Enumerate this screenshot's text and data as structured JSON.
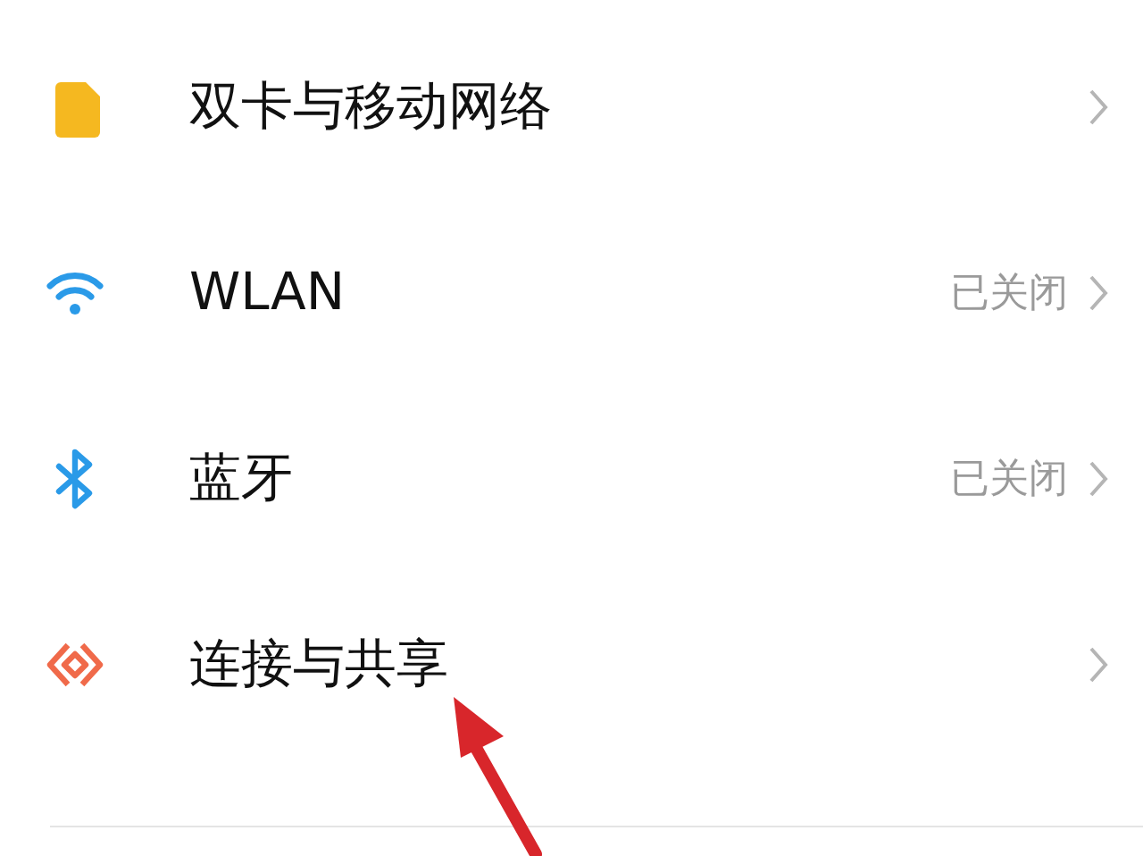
{
  "settings": [
    {
      "kind": "sim",
      "label": "双卡与移动网络"
    },
    {
      "kind": "wifi",
      "label": "WLAN",
      "status": "已关闭"
    },
    {
      "kind": "bluetooth",
      "label": "蓝牙",
      "status": "已关闭"
    },
    {
      "kind": "share",
      "label": "连接与共享"
    }
  ]
}
